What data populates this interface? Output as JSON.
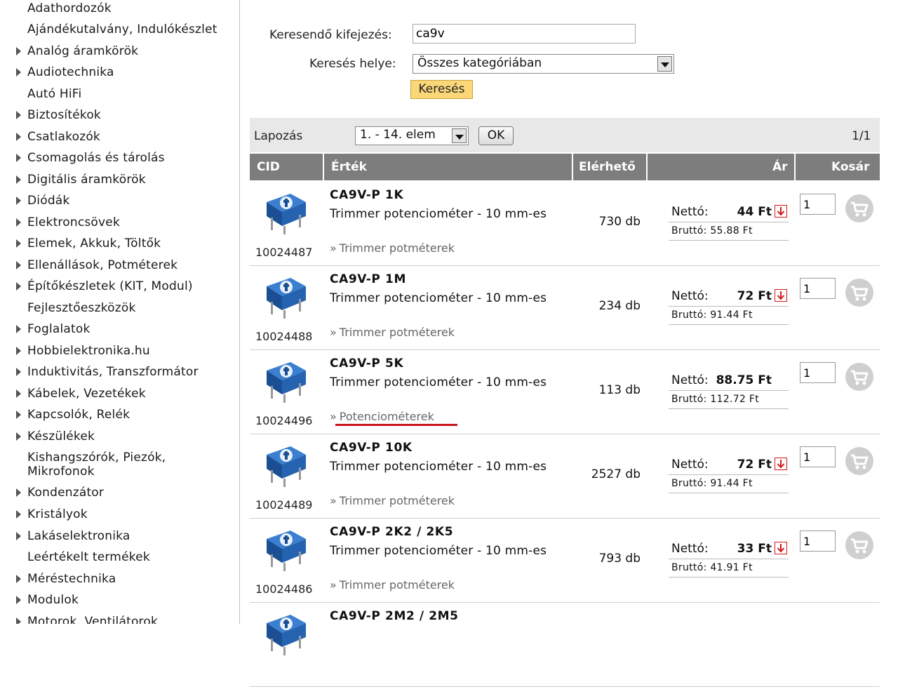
{
  "sidebar": {
    "categories": [
      {
        "label": "Adathordozók",
        "arrow": false
      },
      {
        "label": "Ajándékutalvány, Indulókészlet",
        "arrow": false
      },
      {
        "label": "Analóg áramkörök",
        "arrow": true
      },
      {
        "label": "Audiotechnika",
        "arrow": true
      },
      {
        "label": "Autó HiFi",
        "arrow": false
      },
      {
        "label": "Biztosítékok",
        "arrow": true
      },
      {
        "label": "Csatlakozók",
        "arrow": true
      },
      {
        "label": "Csomagolás és tárolás",
        "arrow": true
      },
      {
        "label": "Digitális áramkörök",
        "arrow": true
      },
      {
        "label": "Diódák",
        "arrow": true
      },
      {
        "label": "Elektroncsövek",
        "arrow": true
      },
      {
        "label": "Elemek, Akkuk, Töltők",
        "arrow": true
      },
      {
        "label": "Ellenállások, Potméterek",
        "arrow": true
      },
      {
        "label": "Építőkészletek (KIT, Modul)",
        "arrow": true
      },
      {
        "label": "Fejlesztőeszközök",
        "arrow": false
      },
      {
        "label": "Foglalatok",
        "arrow": true
      },
      {
        "label": "Hobbielektronika.hu",
        "arrow": true
      },
      {
        "label": "Induktivitás, Transzformátor",
        "arrow": true
      },
      {
        "label": "Kábelek, Vezetékek",
        "arrow": true
      },
      {
        "label": "Kapcsolók, Relék",
        "arrow": true
      },
      {
        "label": "Készülékek",
        "arrow": true
      },
      {
        "label": "Kishangszórók, Piezók, Mikrofonok",
        "arrow": false
      },
      {
        "label": "Kondenzátor",
        "arrow": true
      },
      {
        "label": "Kristályok",
        "arrow": true
      },
      {
        "label": "Lakáselektronika",
        "arrow": true
      },
      {
        "label": "Leértékelt termékek",
        "arrow": false
      },
      {
        "label": "Méréstechnika",
        "arrow": true
      },
      {
        "label": "Modulok",
        "arrow": true
      },
      {
        "label": "Motorok, Ventilátorok",
        "arrow": true
      }
    ]
  },
  "search": {
    "expression_label": "Keresendő kifejezés:",
    "expression_value": "ca9v",
    "location_label": "Keresés helye:",
    "location_value": "Összes kategóriában",
    "button_label": "Keresés"
  },
  "pagination": {
    "label": "Lapozás",
    "range_value": "1. - 14. elem",
    "ok_label": "OK",
    "page_info": "1/1"
  },
  "table": {
    "headers": {
      "cid": "CID",
      "value": "Érték",
      "available": "Elérhető",
      "price": "Ár",
      "cart": "Kosár"
    },
    "netto_label": "Nettó:",
    "rows": [
      {
        "cid": "10024487",
        "name": "CA9V-P 1K",
        "desc": "Trimmer potenciométer - 10 mm-es",
        "category": "Trimmer potméterek",
        "stock": "730 db",
        "netto": "44 Ft",
        "discount": true,
        "brutto": "Bruttó: 55.88 Ft",
        "qty": "1"
      },
      {
        "cid": "10024488",
        "name": "CA9V-P 1M",
        "desc": "Trimmer potenciométer - 10 mm-es",
        "category": "Trimmer potméterek",
        "stock": "234 db",
        "netto": "72 Ft",
        "discount": true,
        "brutto": "Bruttó: 91.44 Ft",
        "qty": "1"
      },
      {
        "cid": "10024496",
        "name": "CA9V-P 5K",
        "desc": "Trimmer potenciométer - 10 mm-es",
        "category": "Potenciométerek",
        "stock": "113 db",
        "netto": "88.75 Ft",
        "discount": false,
        "brutto": "Bruttó:  112.72 Ft",
        "qty": "1"
      },
      {
        "cid": "10024489",
        "name": "CA9V-P 10K",
        "desc": "Trimmer potenciométer - 10 mm-es",
        "category": "Trimmer potméterek",
        "stock": "2527 db",
        "netto": "72 Ft",
        "discount": true,
        "brutto": "Bruttó: 91.44 Ft",
        "qty": "1"
      },
      {
        "cid": "10024486",
        "name": "CA9V-P 2K2 / 2K5",
        "desc": "Trimmer potenciométer - 10 mm-es",
        "category": "Trimmer potméterek",
        "stock": "793 db",
        "netto": "33 Ft",
        "discount": true,
        "brutto": "Bruttó: 41.91 Ft",
        "qty": "1"
      },
      {
        "cid": "",
        "name": "CA9V-P 2M2 / 2M5",
        "desc": "",
        "category": "",
        "stock": "",
        "netto": "",
        "discount": false,
        "brutto": "",
        "qty": ""
      }
    ]
  },
  "colors": {
    "header_bg": "#7d7d7d",
    "pagebar_bg": "#e8e8e8",
    "search_button": "#fbd778",
    "highlight_underline": "#c8141e",
    "discount_arrow": "#d11a1a"
  },
  "icons": {
    "category_arrow": "triangle-right-icon",
    "product_thumb": "trimmer-potentiometer-icon",
    "discount": "arrow-down-icon",
    "cart": "cart-icon",
    "dropdown": "chevron-down-icon"
  }
}
